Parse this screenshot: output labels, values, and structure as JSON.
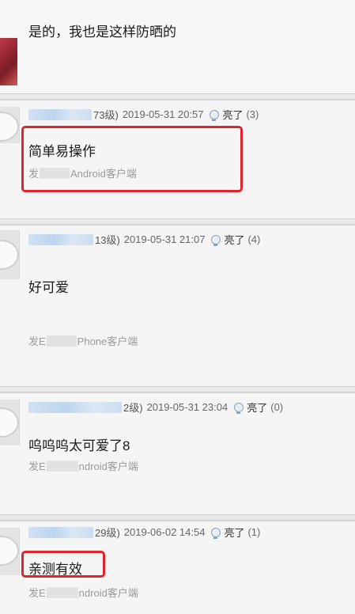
{
  "comments": [
    {
      "text": "是的，我也是这样防晒的"
    },
    {
      "level": "73级)",
      "date": "2019-05-31 20:57",
      "like_label": "亮了",
      "like_count": "(3)",
      "text": "简单易操作",
      "client_prefix": "发",
      "client_suffix": "Android客户端"
    },
    {
      "level": "13级)",
      "date": "2019-05-31 21:07",
      "like_label": "亮了",
      "like_count": "(4)",
      "text": "好可爱",
      "client_prefix": "发E",
      "client_suffix": "Phone客户端"
    },
    {
      "level": "2级)",
      "date": "2019-05-31 23:04",
      "like_label": "亮了",
      "like_count": "(0)",
      "text": "呜呜呜太可爱了8",
      "client_prefix": "发E",
      "client_suffix": "ndroid客户端"
    },
    {
      "level": "29级)",
      "date": "2019-06-02 14:54",
      "like_label": "亮了",
      "like_count": "(1)",
      "text": "亲测有效",
      "client_prefix": "发E",
      "client_suffix": "ndroid客户端"
    }
  ],
  "colors": {
    "highlight_box": "#e0242b",
    "name_blur": "#b9d3ee",
    "background": "#f4f4f4"
  },
  "icons": {
    "like": "lightbulb-icon",
    "avatar": "avatar-placeholder"
  }
}
